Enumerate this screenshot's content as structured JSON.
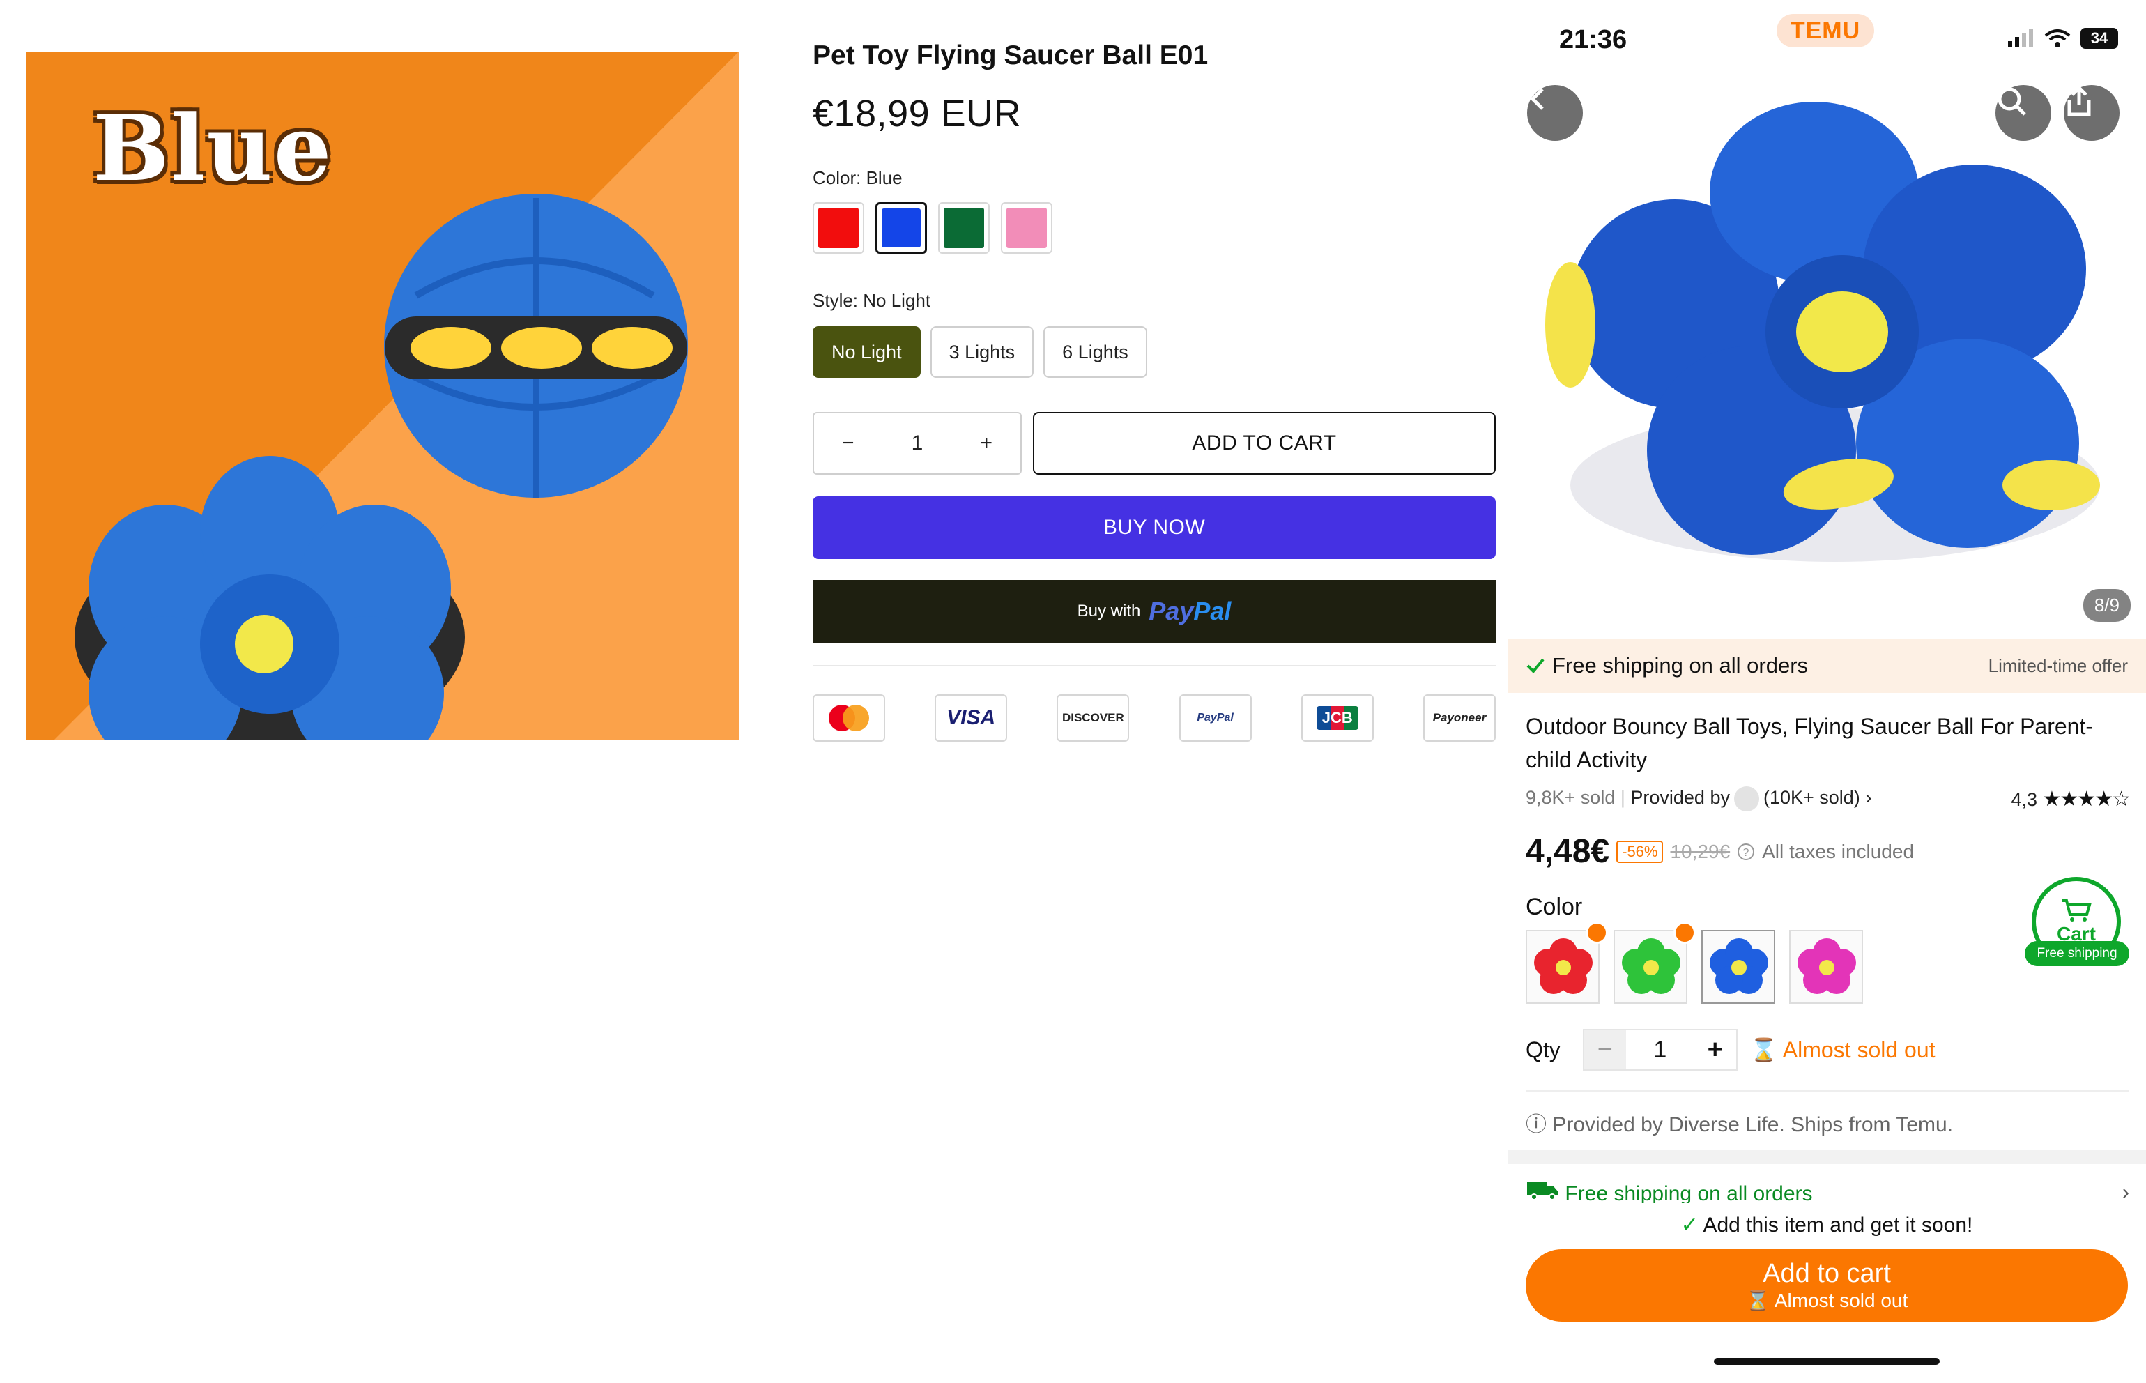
{
  "hero": {
    "label": "Blue"
  },
  "store": {
    "title": "Pet Toy Flying Saucer Ball E01",
    "price": "€18,99 EUR",
    "color_label": "Color: Blue",
    "colors": [
      {
        "name": "Red",
        "hex": "#f20d0d"
      },
      {
        "name": "Blue",
        "hex": "#1445e8"
      },
      {
        "name": "Green",
        "hex": "#0b6b35"
      },
      {
        "name": "Pink",
        "hex": "#f28db8"
      }
    ],
    "selected_color": "Blue",
    "style_label": "Style: No Light",
    "styles": [
      "No Light",
      "3 Lights",
      "6 Lights"
    ],
    "selected_style": "No Light",
    "qty_minus": "−",
    "qty_value": "1",
    "qty_plus": "+",
    "add_to_cart": "ADD TO CART",
    "buy_now": "BUY NOW",
    "buy_with": "Buy with",
    "paypal_a": "Pay",
    "paypal_b": "Pal",
    "payment_icons": [
      "mastercard-icon",
      "visa-icon",
      "discover-icon",
      "paypal-icon",
      "jcb-icon",
      "payoneer-icon"
    ],
    "visa_text": "VISA",
    "discover_text": "DISCOVER",
    "paypal_text": "PayPal",
    "jcb_text": "JCB",
    "payoneer_text": "Payoneer"
  },
  "phone": {
    "time": "21:36",
    "logo": "TEMU",
    "battery": "34",
    "image_counter": "8/9",
    "offer_left": "Free shipping on all orders",
    "offer_right": "Limited-time offer",
    "title": "Outdoor Bouncy Ball Toys, Flying Saucer Ball For Parent-child Activity",
    "sold": "9,8K+ sold",
    "provided_by": "Provided by",
    "seller_sold": "(10K+ sold)",
    "rating": "4,3",
    "stars": "★★★★☆",
    "price": "4,48€",
    "discount": "-56%",
    "old_price": "10,29€",
    "taxes": "All taxes included",
    "color_title": "Color",
    "color_thumbs": [
      {
        "name": "red",
        "hex": "#e8242e",
        "hot": true
      },
      {
        "name": "green",
        "hex": "#2ec33a",
        "hot": true
      },
      {
        "name": "blue",
        "hex": "#1f5fe0",
        "hot": false
      },
      {
        "name": "pink",
        "hex": "#e334b8",
        "hot": false
      }
    ],
    "cart_label": "Cart",
    "cart_tag": "Free shipping",
    "qty_label": "Qty",
    "qty_value": "1",
    "almost_sold_out": "Almost sold out",
    "provided_note": "Provided by Diverse Life. Ships from Temu.",
    "shipping_row": "Free shipping on all orders",
    "add_note": "Add this item and get it soon!",
    "add_cart": "Add to cart",
    "add_cart_sub": "Almost sold out"
  },
  "colors": {
    "accent_orange": "#fb7701",
    "buy_now": "#4531e3",
    "style_selected": "#4a530f",
    "green": "#0ea72b"
  }
}
